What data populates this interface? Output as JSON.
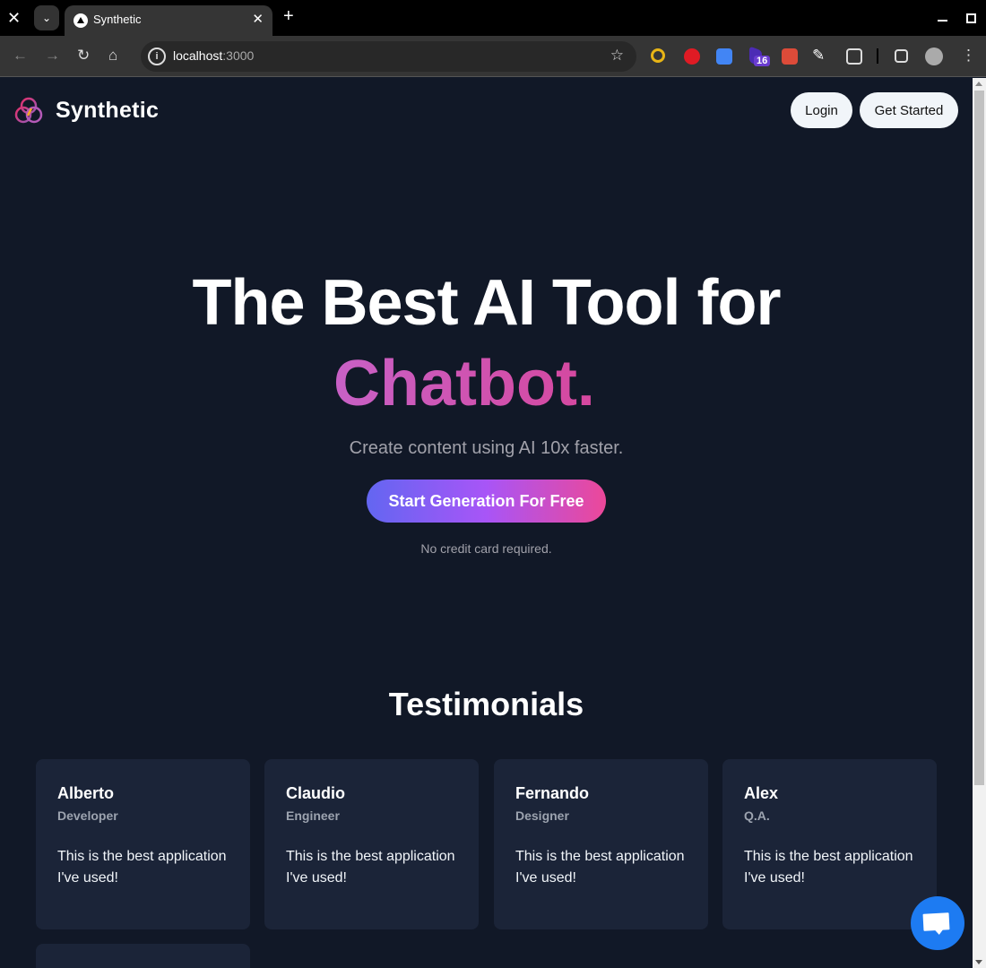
{
  "browser": {
    "tab_title": "Synthetic",
    "url_host": "localhost",
    "url_port": ":3000",
    "extension_badge": "16"
  },
  "nav": {
    "brand": "Synthetic",
    "login": "Login",
    "get_started": "Get Started"
  },
  "hero": {
    "title_line1": "The Best AI Tool for",
    "title_highlight": "Chatbot.",
    "subtitle": "Create content using AI 10x faster.",
    "cta": "Start Generation For Free",
    "note": "No credit card required."
  },
  "testimonials": {
    "heading": "Testimonials",
    "items": [
      {
        "name": "Alberto",
        "role": "Developer",
        "text": "This is the best application I've used!"
      },
      {
        "name": "Claudio",
        "role": "Engineer",
        "text": "This is the best application I've used!"
      },
      {
        "name": "Fernando",
        "role": "Designer",
        "text": "This is the best application I've used!"
      },
      {
        "name": "Alex",
        "role": "Q.A.",
        "text": "This is the best application I've used!"
      }
    ]
  },
  "colors": {
    "background": "#111827",
    "card": "#1b2438",
    "gradient_start": "#6366f1",
    "gradient_mid": "#a855f7",
    "gradient_end": "#ec4899",
    "chat_button": "#1d7bf2"
  }
}
